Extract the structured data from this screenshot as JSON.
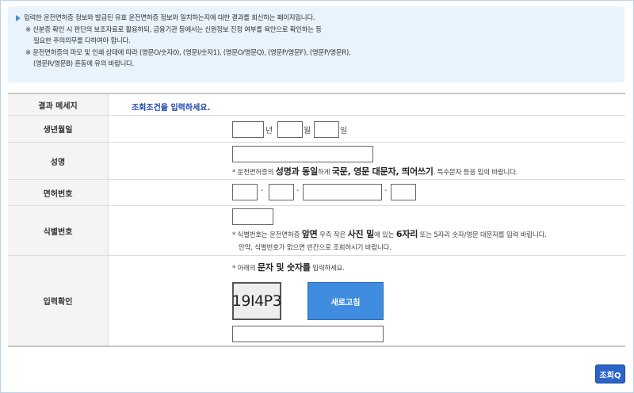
{
  "notice": {
    "line1": "입력한 운전면허증 정보와 발급된 유효 운전면허증 정보와 일치하는지에 대한 결과를 회신하는 페이지입니다.",
    "line2": "※ 신분증 확인 시 판단의 보조자료로 활용하되, 금융기관 등에서는 신원정보 진정 여부를 육안으로 확인하는 등",
    "line3": "필요한 주의의무를 다하여야 합니다.",
    "line4": "※ 운전면허증의 마모 및 인쇄 상태에 따라 (영문O/숫자0), (영문I/숫자1), (영문O/영문Q), (영문P/영문F), (영문P/영문R),",
    "line5": "(영문R/영문B) 혼동에 유의 바랍니다."
  },
  "form": {
    "result": {
      "label": "결과 메세지",
      "message": "조회조건을 입력하세요."
    },
    "birth": {
      "label": "생년월일",
      "year_unit": "년",
      "month_unit": "월",
      "day_unit": "일"
    },
    "name": {
      "label": "성명",
      "hint_prefix": "* 운전면허증의 ",
      "hint_bold1": "성명과 동일",
      "hint_mid1": "하게 ",
      "hint_bold2": "국문, 영문 대문자, 띄어쓰기",
      "hint_suffix": ". 특수문자 등을 입력 바랍니다."
    },
    "license": {
      "label": "면허번호",
      "sep": "-"
    },
    "serial": {
      "label": "식별번호",
      "hint_prefix": "* 식별번호는 운전면허증 ",
      "hint_bold1": "앞면",
      "hint_mid1": " 우측 작은 ",
      "hint_bold2": "사진 밑",
      "hint_mid2": "에 있는 ",
      "hint_bold3": "6자리",
      "hint_suffix": " 또는 5자리 숫자/영문 대문자를 입력 바랍니다.",
      "hint2": "만약, 식별번호가 없으면 빈칸으로 조회하시기 바랍니다."
    },
    "captcha": {
      "label": "입력확인",
      "hint_prefix": "* 아래의 ",
      "hint_bold": "문자 및 숫자를",
      "hint_suffix": " 입력하세요.",
      "code": "19I4P3",
      "refresh_label": "새로고침"
    }
  },
  "search_button": "조회Q"
}
